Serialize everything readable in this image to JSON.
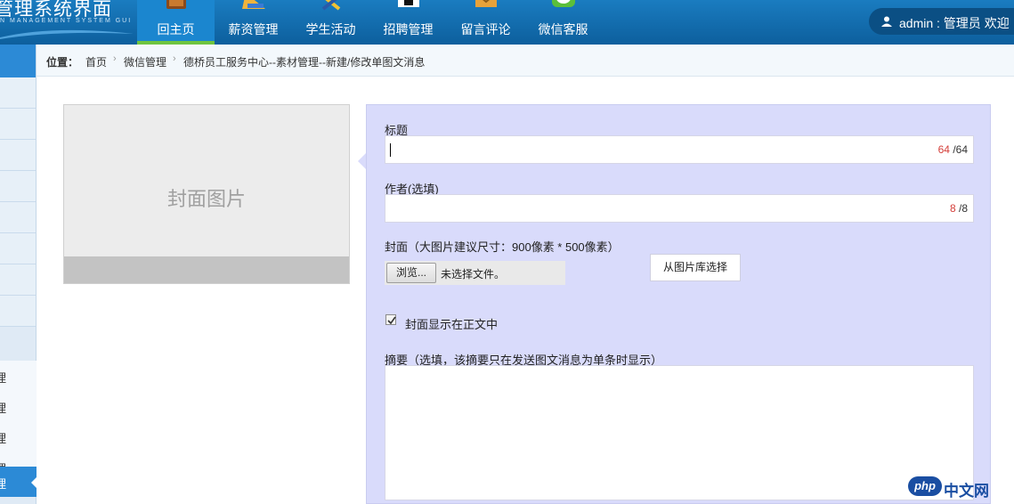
{
  "header": {
    "app_title": "管理系统界面",
    "app_subtitle": "N MANAGEMENT SYSTEM GUI",
    "nav": [
      {
        "label": "回主页",
        "icon": "home-book-icon",
        "active": true
      },
      {
        "label": "薪资管理",
        "icon": "salary-ruler-icon",
        "active": false
      },
      {
        "label": "学生活动",
        "icon": "activity-tools-icon",
        "active": false
      },
      {
        "label": "招聘管理",
        "icon": "recruit-icon",
        "active": false
      },
      {
        "label": "留言评论",
        "icon": "message-mail-icon",
        "active": false
      },
      {
        "label": "微信客服",
        "icon": "wechat-icon",
        "active": false
      }
    ],
    "user_text": "admin : 管理员  欢迎"
  },
  "sidebar": {
    "sub_items": [
      "理",
      "理",
      "理",
      "理",
      "理"
    ],
    "active_index": 4
  },
  "breadcrumb": {
    "label": "位置：",
    "items": [
      "首页",
      "微信管理",
      "德桥员工服务中心--素材管理--新建/修改单图文消息"
    ]
  },
  "cover": {
    "placeholder": "封面图片"
  },
  "form": {
    "title_label": "标题",
    "title_count": "64",
    "title_max": "/64",
    "author_label": "作者(选填)",
    "author_count": "8",
    "author_max": "/8",
    "cover_label": "封面（大图片建议尺寸：900像素 * 500像素）",
    "browse_label": "浏览...",
    "file_status": "未选择文件。",
    "library_button": "从图片库选择",
    "show_cover_label": "封面显示在正文中",
    "show_cover_checked": true,
    "summary_label": "摘要（选填，该摘要只在发送图文消息为单条时显示）"
  },
  "watermark": {
    "logo": "php",
    "text": "中文网"
  },
  "colors": {
    "header_bg": "#0d5f9d",
    "active_tab": "#1b86cf",
    "active_tab_underline": "#6ec43f",
    "panel_bg": "#d9dbfb",
    "counter_red": "#d43f3a"
  }
}
